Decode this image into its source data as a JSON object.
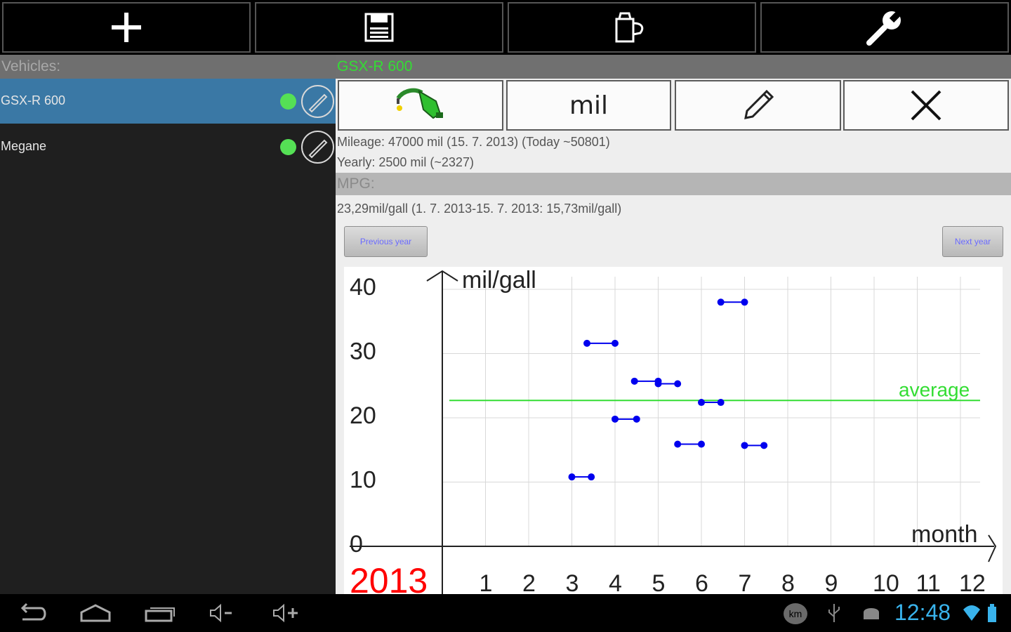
{
  "toolbar": {
    "buttons": [
      {
        "icon": "add-icon"
      },
      {
        "icon": "save-icon"
      },
      {
        "icon": "fuel-can-icon"
      },
      {
        "icon": "wrench-icon"
      }
    ]
  },
  "vehicles": {
    "header": "Vehicles:",
    "items": [
      {
        "name": "GSX-R 600",
        "selected": true,
        "status_color": "#55e055"
      },
      {
        "name": "Megane",
        "selected": false,
        "status_color": "#55e055"
      }
    ]
  },
  "detail": {
    "title": "GSX-R 600",
    "title_color": "#33dd33",
    "actions": [
      {
        "icon": "fuel-pump-icon"
      },
      {
        "label": "mil"
      },
      {
        "icon": "pencil-icon"
      },
      {
        "icon": "close-icon"
      }
    ],
    "mileage": "Mileage: 47000 mil (15. 7. 2013)   (Today ~50801)",
    "yearly": "Yearly: 2500 mil   (~2327)",
    "mpg_header": "MPG:",
    "mpg_value": "23,29mil/gall (1. 7. 2013-15. 7. 2013: 15,73mil/gall)",
    "prev_year": "Previous year",
    "next_year": "Next year"
  },
  "chart_data": {
    "type": "scatter",
    "year": "2013",
    "year_color": "#ff0000",
    "xlabel": "month",
    "ylabel": "mil/gall",
    "x_ticks": [
      "1",
      "2",
      "3",
      "4",
      "5",
      "6",
      "7",
      "8",
      "9",
      "10",
      "11",
      "12"
    ],
    "y_ticks": [
      "0",
      "10",
      "20",
      "30",
      "40"
    ],
    "xlim": [
      0,
      12.5
    ],
    "ylim": [
      0,
      40
    ],
    "grid": true,
    "series_color": "#0000ee",
    "segments": [
      {
        "x1": 3.0,
        "x2": 3.45,
        "y": 10.8
      },
      {
        "x1": 3.35,
        "x2": 4.0,
        "y": 31.6
      },
      {
        "x1": 4.0,
        "x2": 4.5,
        "y": 19.8
      },
      {
        "x1": 4.45,
        "x2": 5.0,
        "y": 25.7
      },
      {
        "x1": 5.0,
        "x2": 5.45,
        "y": 25.3
      },
      {
        "x1": 5.45,
        "x2": 6.0,
        "y": 15.9
      },
      {
        "x1": 6.0,
        "x2": 6.45,
        "y": 22.4
      },
      {
        "x1": 6.45,
        "x2": 7.0,
        "y": 38.0
      },
      {
        "x1": 7.0,
        "x2": 7.45,
        "y": 15.7
      }
    ],
    "average": {
      "label": "average",
      "value": 22.7,
      "color": "#33dd33"
    }
  },
  "status_bar": {
    "nav_icons": [
      "back-icon",
      "home-icon",
      "recent-apps-icon",
      "volume-down-icon",
      "volume-up-icon"
    ],
    "status_icons": [
      "km-icon",
      "usb-icon",
      "android-debug-icon",
      "wifi-icon",
      "battery-icon"
    ],
    "km_label": "km",
    "time": "12:48",
    "accent": "#39b3ec"
  }
}
